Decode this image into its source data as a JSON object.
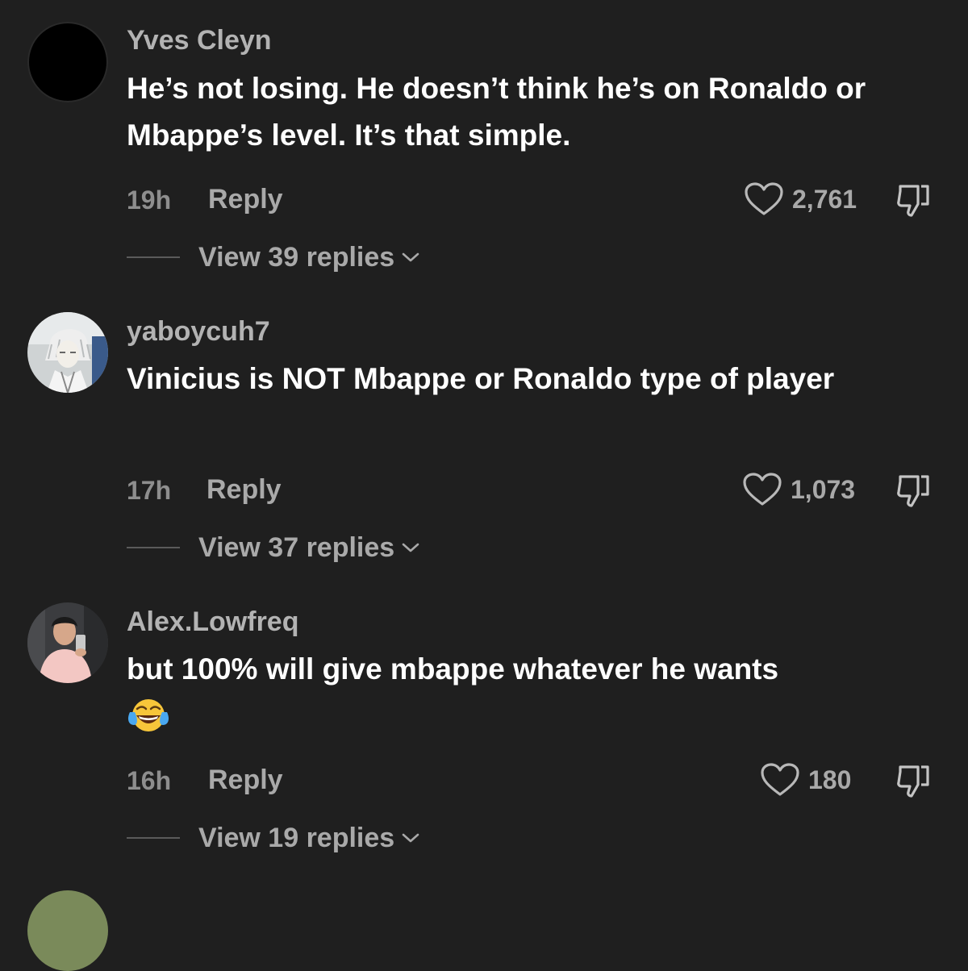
{
  "comments": [
    {
      "username": "Yves Cleyn",
      "text": "He’s not losing. He doesn’t think he’s on Ronaldo or Mbappe’s level. It’s that simple.",
      "time": "19h",
      "reply_label": "Reply",
      "likes": "2,761",
      "view_replies": "View 39 replies",
      "avatar": "black-circle"
    },
    {
      "username": "yaboycuh7",
      "text": "Vinicius is NOT Mbappe or Ronaldo type of player",
      "time": "17h",
      "reply_label": "Reply",
      "likes": "1,073",
      "view_replies": "View 37 replies",
      "avatar": "anime-character"
    },
    {
      "username": "Alex.Lowfreq",
      "text": "but 100% will give mbappe whatever he wants",
      "emoji": "face-with-tears-of-joy",
      "time": "16h",
      "reply_label": "Reply",
      "likes": "180",
      "view_replies": "View 19 replies",
      "avatar": "person-photo"
    }
  ],
  "colors": {
    "background": "#1f1f1f",
    "username": "#b3b3b3",
    "text": "#ffffff",
    "meta": "#a9a9a9"
  },
  "icons": {
    "like": "heart-outline-icon",
    "dislike": "thumbs-down-icon",
    "expand": "chevron-down-icon"
  }
}
